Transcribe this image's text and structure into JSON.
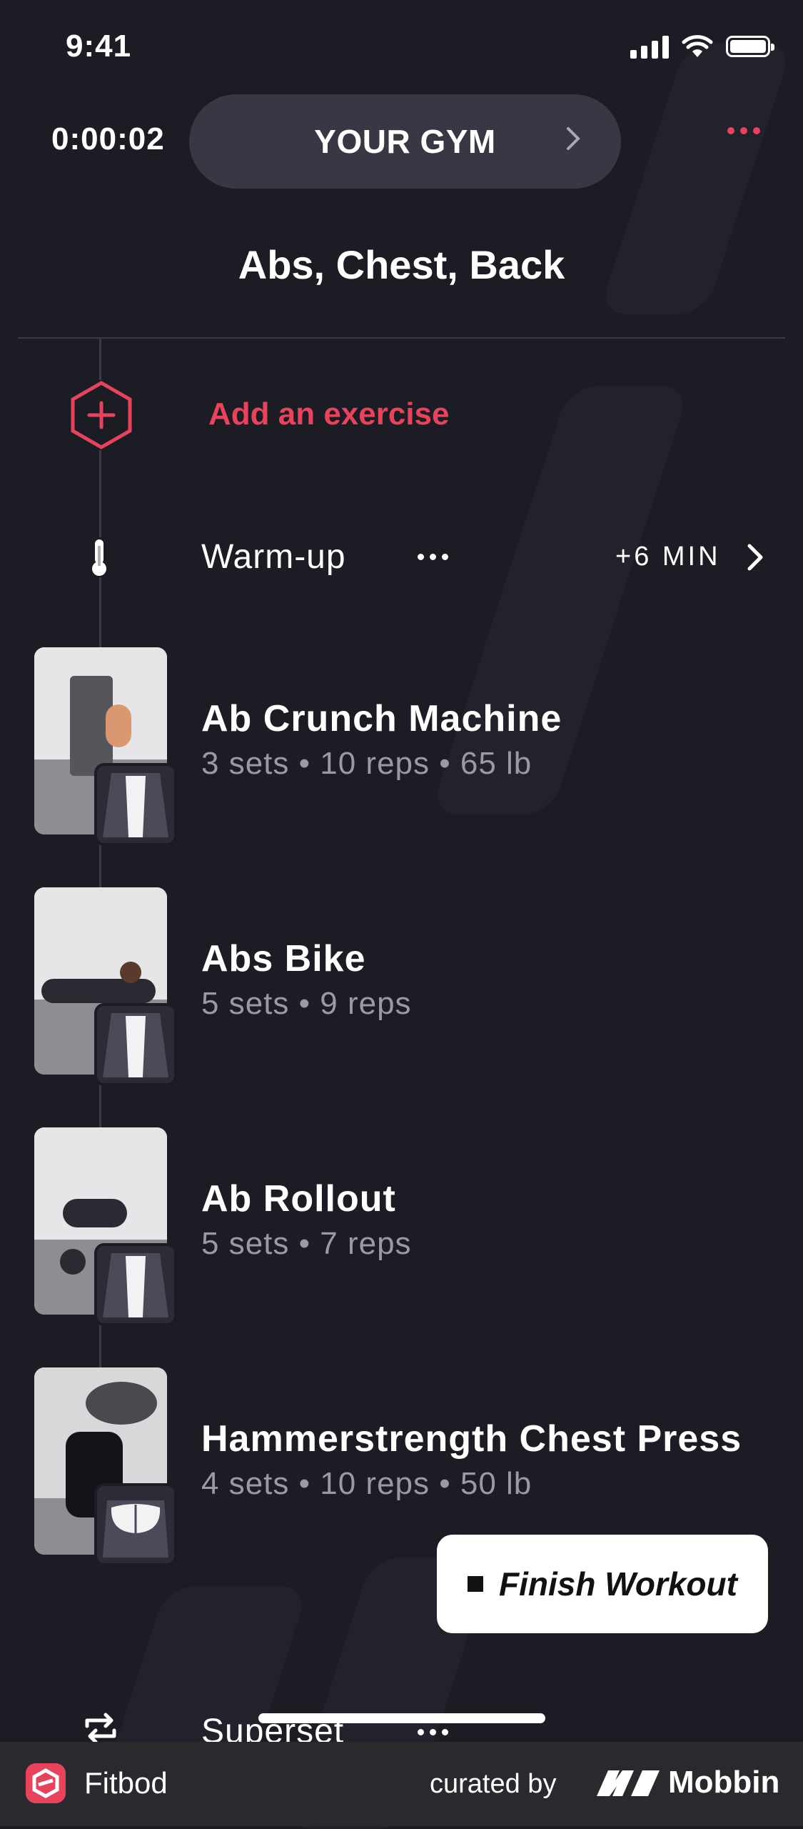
{
  "status_bar": {
    "time": "9:41"
  },
  "header": {
    "timer": "0:00:02",
    "gym_label": "YOUR GYM",
    "title": "Abs, Chest, Back"
  },
  "add_exercise": {
    "label": "Add an exercise"
  },
  "warmup": {
    "label": "Warm-up",
    "time": "+6 MIN"
  },
  "exercises": [
    {
      "name": "Ab Crunch Machine",
      "detail": "3 sets • 10 reps • 65 lb"
    },
    {
      "name": "Abs Bike",
      "detail": "5 sets • 9 reps"
    },
    {
      "name": "Ab Rollout",
      "detail": "5 sets • 7 reps"
    },
    {
      "name": "Hammerstrength Chest Press",
      "detail": "4 sets • 10 reps • 50 lb"
    }
  ],
  "finish_button": {
    "label": "Finish Workout"
  },
  "superset": {
    "label": "Superset"
  },
  "footer": {
    "app_name": "Fitbod",
    "curated_label": "curated by",
    "brand": "Mobbin"
  },
  "colors": {
    "background": "#1c1c24",
    "accent": "#e8435d",
    "pill": "#383844",
    "muted_text": "#9a9aa6"
  }
}
